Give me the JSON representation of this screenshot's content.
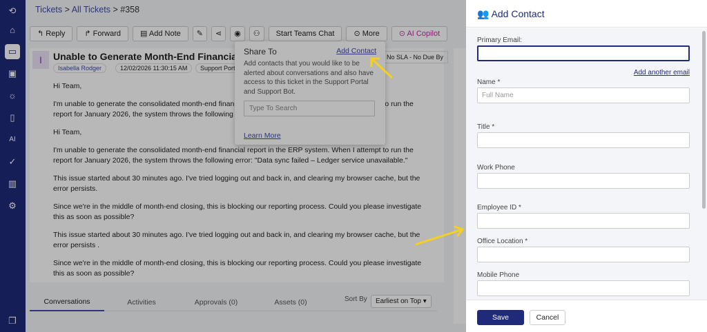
{
  "breadcrumb": {
    "tickets": "Tickets",
    "all": "All Tickets",
    "id": "#358",
    "sep": ">"
  },
  "toolbar": {
    "reply": "↰ Reply",
    "forward": "↱ Forward",
    "add_note": "▤ Add Note",
    "teams": "Start Teams Chat",
    "more": "⊙ More",
    "ai": "⊙ AI Copilot"
  },
  "ticket": {
    "avatar": "I",
    "title": "Unable to Generate Month-End Financial Report in",
    "requester": "Isabella Rodger",
    "date": "12/02/2026 11:30:15 AM",
    "source": "Support Portal",
    "sla": "No SLA - No Due By",
    "body": [
      "Hi Team,",
      "I'm unable to generate the consolidated month-end financial report in the ERP system. When I attempt to run the report for January 2026, the system throws the following error:",
      "Hi Team,",
      "I'm unable to generate the consolidated month-end financial report in the ERP system. When I attempt to run the report for January 2026, the system throws the following error: \"Data sync failed – Ledger service unavailable.\"",
      "This issue started about 30 minutes ago. I've tried logging out and back in, and clearing my browser cache, but the error persists.",
      "Since we're in the middle of month-end closing, this is blocking our reporting process. Could you please investigate this as soon as possible?",
      "This issue started about 30 minutes ago. I've tried logging out and back in, and clearing my browser cache, but the error persists .",
      "Since we're in the middle of month-end closing, this is blocking our reporting process. Could you please investigate this as soon as possible?"
    ]
  },
  "tabs": [
    "Conversations",
    "Activities",
    "Approvals (0)",
    "Assets (0)"
  ],
  "sort": {
    "label": "Sort By",
    "value": "Earliest on Top ▾"
  },
  "popover": {
    "title": "Share To",
    "add_contact": "Add Contact",
    "description": "Add contacts that you would like to be alerted about conversations and also have access to this ticket in the Support Portal and Support Bot.",
    "search_placeholder": "Type To Search",
    "learn_more": "Learn More"
  },
  "panel": {
    "title": "Add Contact",
    "add_another_email": "Add another email",
    "save": "Save",
    "cancel": "Cancel",
    "fields": [
      {
        "label": "Primary Email:",
        "placeholder": ""
      },
      {
        "label": "Name *",
        "placeholder": "Full Name"
      },
      {
        "label": "Title *",
        "placeholder": ""
      },
      {
        "label": "Work Phone",
        "placeholder": ""
      },
      {
        "label": "Employee ID *",
        "placeholder": ""
      },
      {
        "label": "Office Location *",
        "placeholder": ""
      },
      {
        "label": "Mobile Phone",
        "placeholder": ""
      }
    ]
  },
  "colors": {
    "primary": "#1f2a7a",
    "link": "#3e4aa8",
    "ai": "#c02aa8",
    "arrow": "#f5d020"
  }
}
